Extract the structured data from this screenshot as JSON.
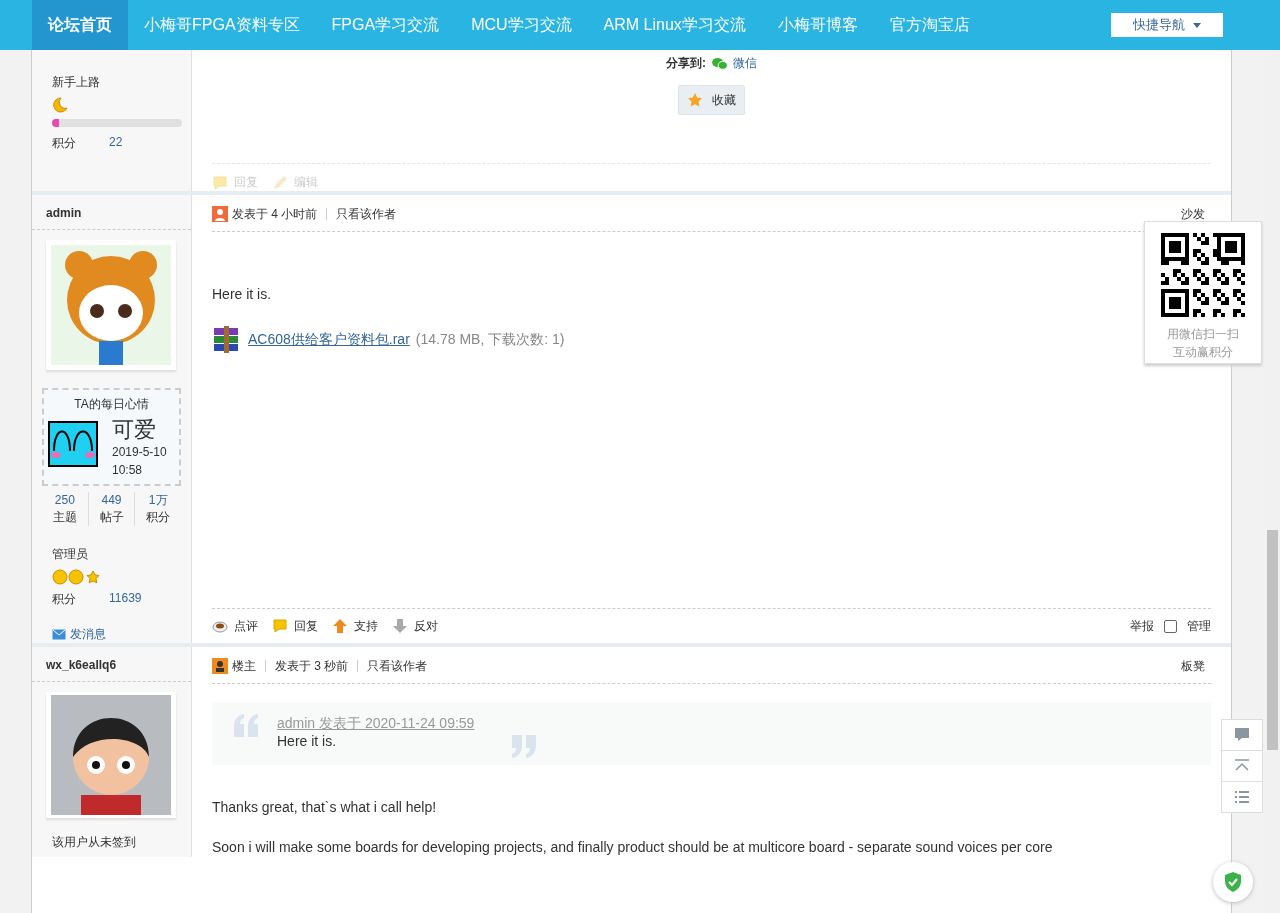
{
  "nav": {
    "items": [
      {
        "label": "论坛首页",
        "selected": true
      },
      {
        "label": "小梅哥FPGA资料专区",
        "selected": false
      },
      {
        "label": "FPGA学习交流",
        "selected": false
      },
      {
        "label": "MCU学习交流",
        "selected": false
      },
      {
        "label": "ARM Linux学习交流",
        "selected": false
      },
      {
        "label": "小梅哥博客",
        "selected": false
      },
      {
        "label": "官方淘宝店",
        "selected": false
      }
    ],
    "quick_nav": "快捷导航"
  },
  "post_tail": {
    "sidebar": {
      "rank": "新手上路",
      "level": 0.05,
      "points_label": "积分",
      "points": "22"
    },
    "share_label": "分享到:",
    "share_target": "微信",
    "favorite": "收藏",
    "actions": [
      {
        "kind": "reply",
        "label": "回复",
        "disabled": true
      },
      {
        "kind": "edit",
        "label": "编辑",
        "disabled": true
      }
    ]
  },
  "post_admin": {
    "author": "admin",
    "mood": {
      "title": "TA的每日心情",
      "text": "可爱",
      "date": "2019-5-10",
      "time": "10:58"
    },
    "stats": [
      {
        "value": "250",
        "label": "主题"
      },
      {
        "value": "449",
        "label": "帖子"
      },
      {
        "value": "1万",
        "label": "积分"
      }
    ],
    "rank": "管理员",
    "points_label": "积分",
    "points": "11639",
    "message": "发消息",
    "meta": [
      {
        "kind": "posted",
        "label": "发表于 4 小时前"
      },
      {
        "kind": "link",
        "label": "只看该作者"
      }
    ],
    "floor": "沙发",
    "body": "Here it is.",
    "attachment": {
      "name": "AC608供给客户资料包.rar",
      "info": "(14.78 MB, 下载次数: 1)"
    },
    "actions": [
      {
        "kind": "comment",
        "label": "点评"
      },
      {
        "kind": "reply",
        "label": "回复"
      },
      {
        "kind": "up",
        "label": "支持"
      },
      {
        "kind": "down",
        "label": "反对"
      }
    ],
    "report": "举报",
    "manage": {
      "label": "管理",
      "checked": false
    }
  },
  "post_reply": {
    "author": "wx_k6eallq6",
    "sign_status": "该用户从未签到",
    "meta": [
      {
        "kind": "owner",
        "label": "楼主"
      },
      {
        "kind": "posted",
        "label": "发表于 3 秒前"
      },
      {
        "kind": "link",
        "label": "只看该作者"
      }
    ],
    "floor": "板凳",
    "quote": {
      "source": "admin 发表于 2020-11-24 09:59",
      "text": "Here it is."
    },
    "paragraphs": [
      "Thanks great, that`s what i call help!",
      "Soon i will make some boards for developing projects, and finally product should be at multicore board - separate sound voices per core"
    ]
  },
  "qr_popup": {
    "lines": [
      "用微信扫一扫",
      "互动赢积分"
    ]
  }
}
